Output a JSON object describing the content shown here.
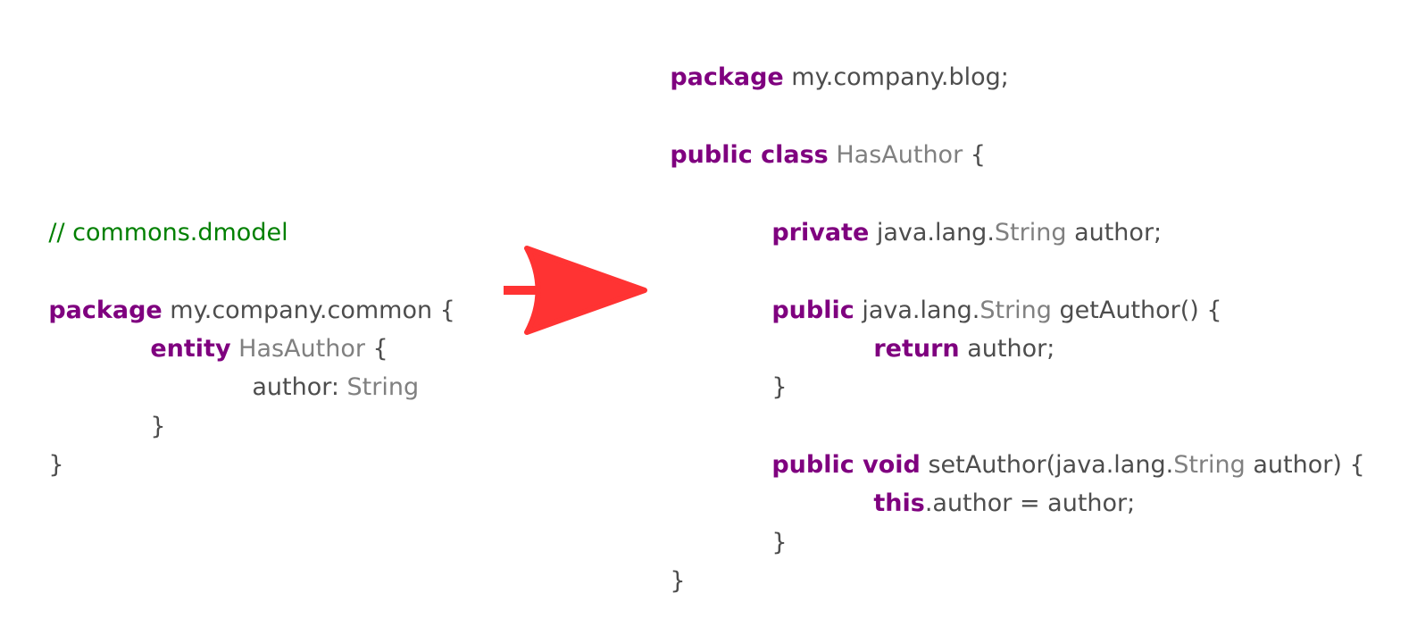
{
  "left_code": {
    "comment": "// commons.dmodel",
    "line_package": {
      "keyword": "package",
      "text": " my.company.common {"
    },
    "line_entity": {
      "keyword": "entity",
      "type": "HasAuthor",
      "text": " {"
    },
    "line_field": {
      "text": "author: ",
      "type": "String"
    },
    "line_close_inner": "}",
    "line_close_outer": "}"
  },
  "right_code": {
    "line_package": {
      "keyword": "package",
      "text": " my.company.blog;"
    },
    "line_class": {
      "keyword": "public class",
      "type": "HasAuthor",
      "text": " {"
    },
    "line_field": {
      "keyword": "private",
      "pre": " java.lang.",
      "type": "String",
      "post": " author;"
    },
    "line_getter": {
      "keyword": "public",
      "pre": " java.lang.",
      "type": "String",
      "post": " getAuthor() {"
    },
    "line_return": {
      "keyword": "return",
      "text": " author;"
    },
    "line_getter_close": "}",
    "line_setter": {
      "keyword": "public void",
      "pre": " setAuthor(java.lang.",
      "type": "String",
      "post": " author) {"
    },
    "line_assign": {
      "keyword": "this",
      "text": ".author = author;"
    },
    "line_setter_close": "}",
    "line_class_close": "}"
  },
  "colors": {
    "keyword": "#7f007f",
    "type": "#808080",
    "comment": "#008000",
    "text": "#4d4d4d",
    "arrow": "#ff3333"
  },
  "icons": {
    "arrow": "right-arrow-icon"
  }
}
